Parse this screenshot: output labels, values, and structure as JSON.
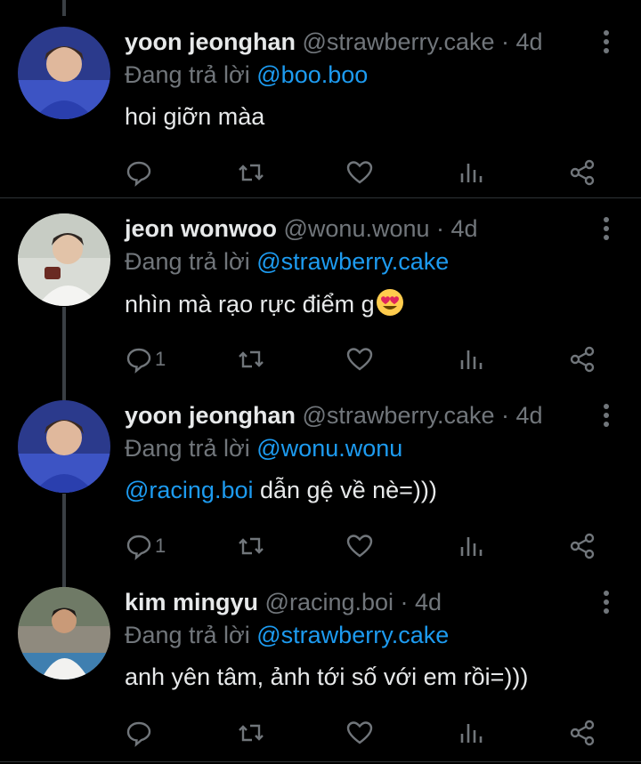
{
  "tweets": [
    {
      "name": "yoon jeonghan",
      "handle": "@strawberry.cake",
      "time": "· 4d",
      "reply_prefix": "Đang trả lời ",
      "reply_to": "@boo.boo",
      "text": "hoi giỡn màa",
      "reply_count": ""
    },
    {
      "name": "jeon wonwoo",
      "handle": "@wonu.wonu",
      "time": "· 4d",
      "reply_prefix": "Đang trả lời ",
      "reply_to": "@strawberry.cake",
      "text": "nhìn mà rạo rực điểm g",
      "reply_count": "1"
    },
    {
      "name": "yoon jeonghan",
      "handle": "@strawberry.cake",
      "time": "· 4d",
      "reply_prefix": "Đang trả lời ",
      "reply_to": "@wonu.wonu",
      "text_mention": "@racing.boi",
      "text": " dẫn gệ về nè=)))",
      "reply_count": "1"
    },
    {
      "name": "kim mingyu",
      "handle": "@racing.boi",
      "time": "· 4d",
      "reply_prefix": "Đang trả lời ",
      "reply_to": "@strawberry.cake",
      "text": "anh yên tâm, ảnh tới số với em rồi=)))",
      "reply_count": ""
    }
  ],
  "colors": {
    "background": "#000000",
    "text": "#e7e9ea",
    "muted": "#71767b",
    "accent": "#1d9bf0",
    "thread_line": "#3a3f44"
  },
  "icons": [
    "reply-icon",
    "retweet-icon",
    "like-icon",
    "views-icon",
    "share-icon",
    "more-icon"
  ]
}
